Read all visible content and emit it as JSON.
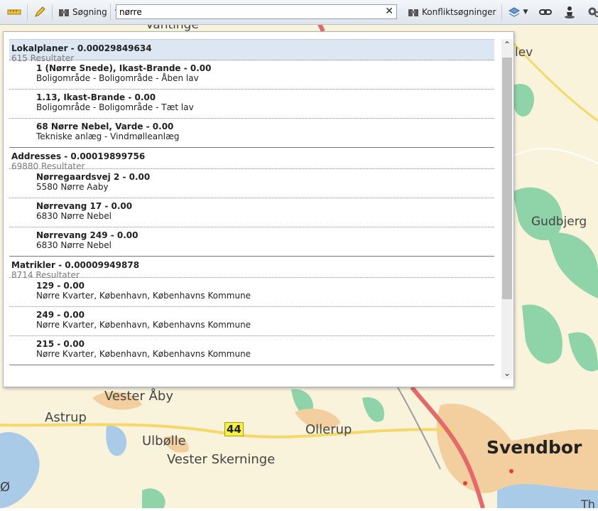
{
  "toolbar": {
    "search_label": "Søgning",
    "conflict_label": "Konfliktsøgninger"
  },
  "search": {
    "value": "nørre"
  },
  "results": {
    "groups": [
      {
        "title": "Lokalplaner - 0.00029849634",
        "count": "615 Resultater",
        "items": [
          {
            "title": "1 (Nørre Snede), Ikast-Brande - 0.00",
            "sub": "Boligområde - Boligområde - Åben lav"
          },
          {
            "title": "1.13, Ikast-Brande - 0.00",
            "sub": "Boligområde - Boligområde - Tæt lav"
          },
          {
            "title": "68 Nørre Nebel, Varde - 0.00",
            "sub": "Tekniske anlæg - Vindmølleanlæg"
          }
        ]
      },
      {
        "title": "Addresses - 0.00019899756",
        "count": "69880 Resultater",
        "items": [
          {
            "title": "Nørregaardsvej 2 - 0.00",
            "sub": "5580 Nørre Aaby"
          },
          {
            "title": "Nørrevang 17 - 0.00",
            "sub": "6830 Nørre Nebel"
          },
          {
            "title": "Nørrevang 249 - 0.00",
            "sub": "6830 Nørre Nebel"
          }
        ]
      },
      {
        "title": "Matrikler - 0.00009949878",
        "count": "8714 Resultater",
        "items": [
          {
            "title": "129 - 0.00",
            "sub": "Nørre Kvarter, København, Københavns Kommune"
          },
          {
            "title": "249 - 0.00",
            "sub": "Nørre Kvarter, København, Københavns Kommune"
          },
          {
            "title": "215 - 0.00",
            "sub": "Nørre Kvarter, København, Københavns Kommune"
          }
        ]
      }
    ]
  },
  "map": {
    "labels": {
      "vantinge": "Vantinge",
      "lev": "lev",
      "gudbjerg": "Gudbjerg",
      "vester_aaby": "Vester Åby",
      "astrup": "Astrup",
      "ulbolle": "Ulbølle",
      "ollerup": "Ollerup",
      "vester_skerninge": "Vester Skerninge",
      "svendborg": "Svendbor",
      "road": "44",
      "edge_bottom_left": "Ø",
      "edge_bottom_right": "Th"
    }
  }
}
